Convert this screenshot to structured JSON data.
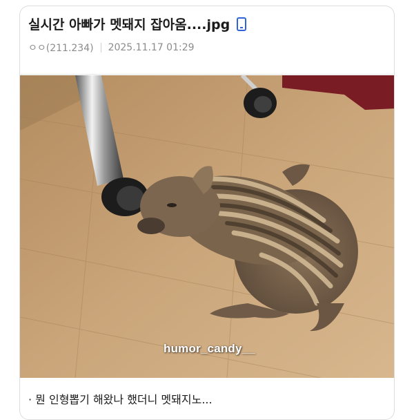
{
  "post": {
    "title": "실시간 아빠가 멧돼지 잡아옴....jpg",
    "author": "ㅇㅇ(211.234)",
    "date": "2025.11.17 01:29",
    "device_icon": "mobile-phone-icon",
    "caption": "· 뭔 인형뽑기 해왔나 했더니 멧돼지노..."
  },
  "photo": {
    "watermark": "humor_candy__"
  },
  "colors": {
    "accent": "#2f64d6",
    "meta_text": "#8b8b8b",
    "title_text": "#1b1b1b"
  }
}
